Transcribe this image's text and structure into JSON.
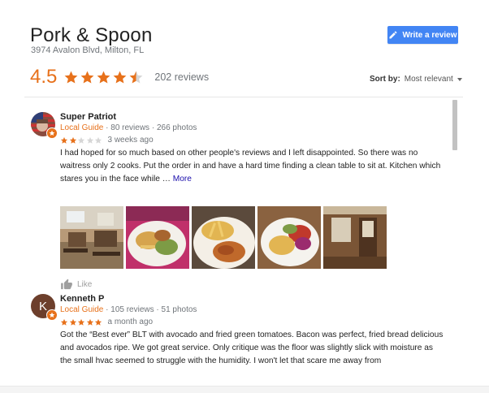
{
  "place": {
    "name": "Pork & Spoon",
    "address": "3974 Avalon Blvd, Milton, FL",
    "rating": "4.5",
    "rating_value": 4.5,
    "review_count": "202 reviews"
  },
  "actions": {
    "write_review_label": "Write a review",
    "sort_label": "Sort by:",
    "sort_value": "Most relevant"
  },
  "colors": {
    "accent": "#e7711b",
    "button": "#4285f4",
    "link": "#1a0dab"
  },
  "reviews": [
    {
      "author": "Super Patriot",
      "badge": "Local Guide",
      "stats": " · 80 reviews · 266 photos",
      "stars": 2,
      "when": "3 weeks ago",
      "text": "I had hoped for so much based on other people's reviews and I left disappointed. So there was no waitress only 2 cooks. Put the order in and have a hard time finding a clean table to sit at. Kitchen which stares you in the face while … ",
      "more": "More",
      "photo_count": 5,
      "like_label": "Like"
    },
    {
      "author": "Kenneth P",
      "avatar_letter": "K",
      "badge": "Local Guide",
      "stats": " · 105 reviews · 51 photos",
      "stars": 5,
      "when": "a month ago",
      "text": "Got the “Best ever” BLT with avocado and fried  green tomatoes. Bacon was perfect, fried bread delicious and avocados ripe. We got great service. Only critique was the floor was slightly slick with moisture as the small hvac seemed to struggle with the humidity. I won't let that scare me away from"
    }
  ]
}
